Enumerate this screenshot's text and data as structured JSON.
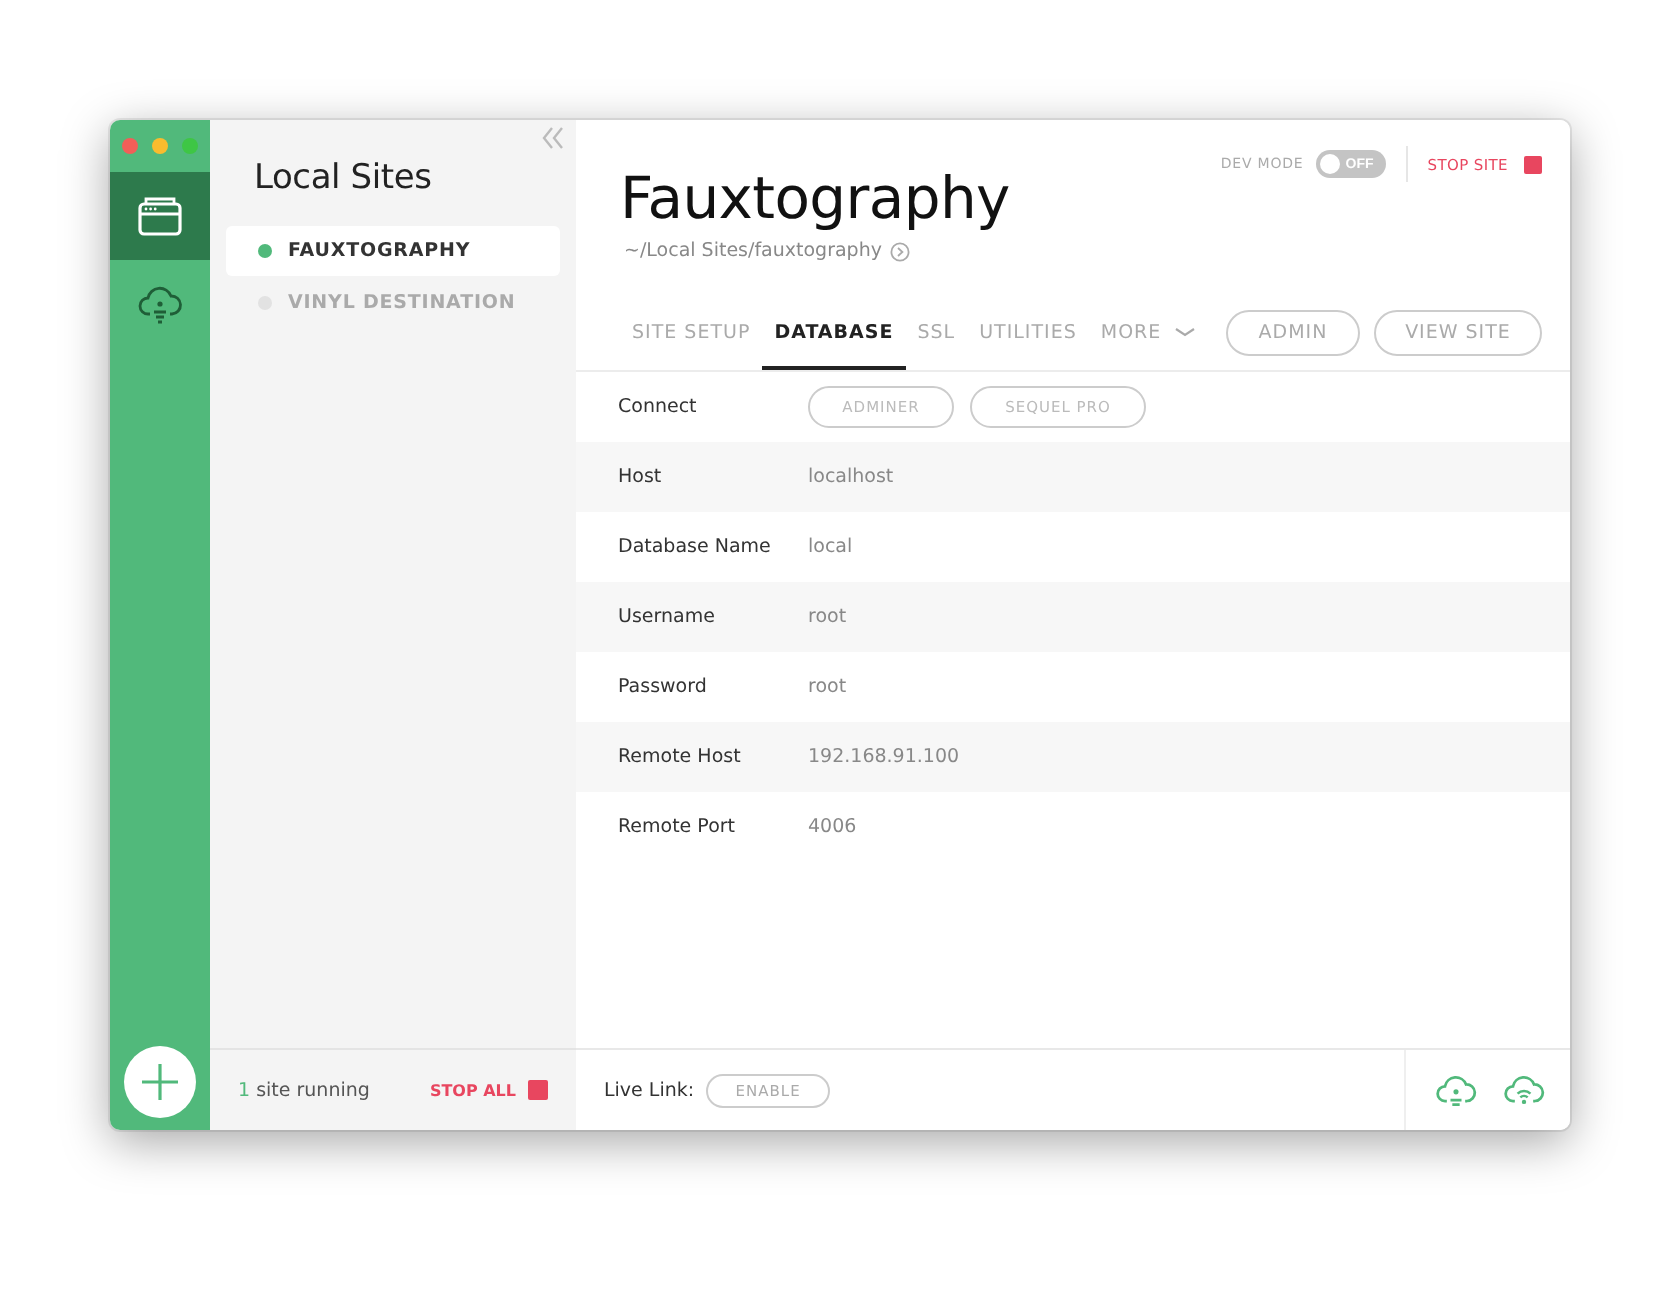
{
  "rail": {
    "items": [
      {
        "kind": "sites",
        "selected": true
      },
      {
        "kind": "connect",
        "selected": false
      }
    ]
  },
  "sidebar": {
    "title": "Local Sites",
    "sites": [
      {
        "name": "FAUXTOGRAPHY",
        "selected": true,
        "running": true
      },
      {
        "name": "VINYL DESTINATION",
        "selected": false,
        "running": false
      }
    ],
    "footer": {
      "count": "1",
      "label": "site running",
      "stop_all": "STOP ALL"
    }
  },
  "site": {
    "title": "Fauxtography",
    "path": "~/Local Sites/fauxtography",
    "dev_mode": {
      "label": "DEV MODE",
      "toggle_text": "OFF",
      "on": false
    },
    "stop_site": "STOP SITE",
    "tabs": [
      {
        "label": "SITE SETUP",
        "selected": false
      },
      {
        "label": "DATABASE",
        "selected": true
      },
      {
        "label": "SSL",
        "selected": false
      },
      {
        "label": "UTILITIES",
        "selected": false
      },
      {
        "label": "MORE",
        "selected": false,
        "kind": "dropdown"
      }
    ],
    "buttons": [
      "ADMIN",
      "VIEW SITE"
    ],
    "rows": [
      {
        "label": "Connect",
        "kind": "buttons",
        "buttons": [
          "ADMINER",
          "SEQUEL PRO"
        ]
      },
      {
        "label": "Host",
        "kind": "value",
        "value": "localhost"
      },
      {
        "label": "Database Name",
        "kind": "value",
        "value": "local"
      },
      {
        "label": "Username",
        "kind": "value",
        "value": "root"
      },
      {
        "label": "Password",
        "kind": "value",
        "value": "root"
      },
      {
        "label": "Remote Host",
        "kind": "value",
        "value": "192.168.91.100"
      },
      {
        "label": "Remote Port",
        "kind": "value",
        "value": "4006"
      }
    ],
    "footer": {
      "live_link_label": "Live Link:",
      "enable": "ENABLE"
    }
  }
}
